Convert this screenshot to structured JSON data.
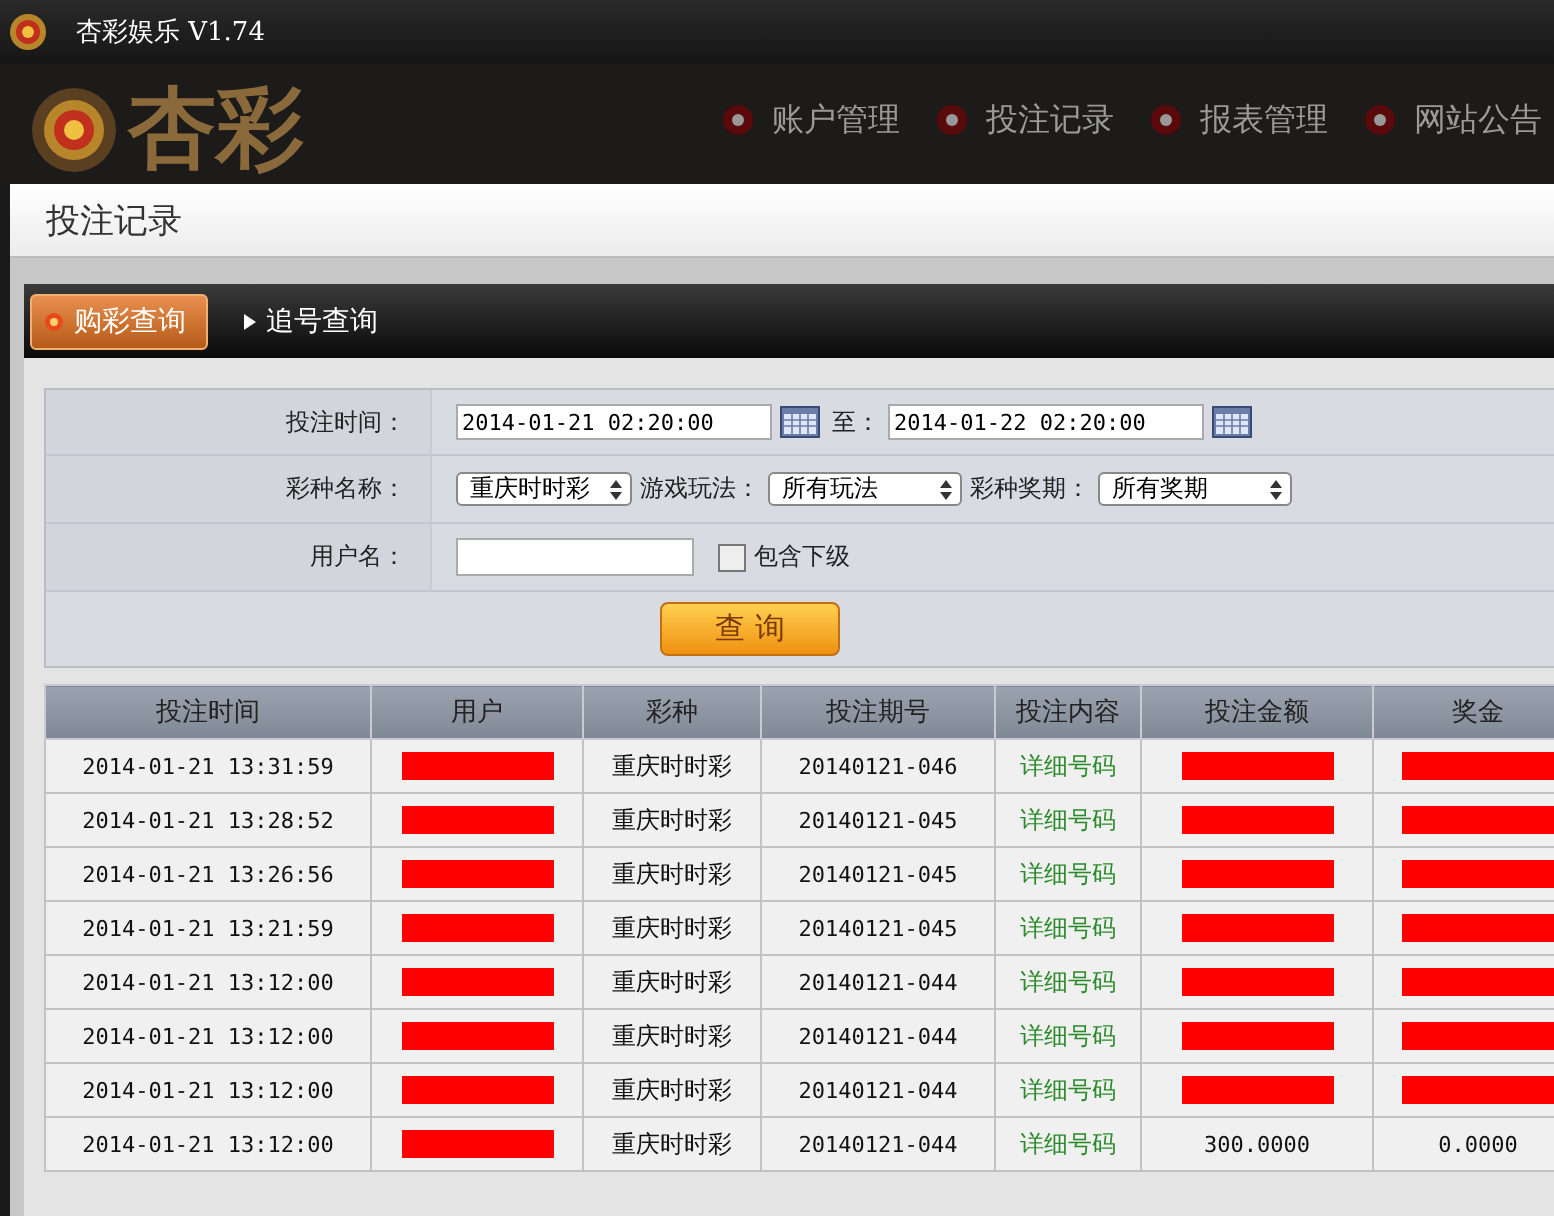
{
  "window": {
    "title": "杏彩娱乐 V1.74"
  },
  "header": {
    "logo_text": "杏彩",
    "nav": [
      {
        "label": "账户管理"
      },
      {
        "label": "投注记录"
      },
      {
        "label": "报表管理"
      },
      {
        "label": "网站公告"
      }
    ]
  },
  "page_title": "投注记录",
  "tabs": [
    {
      "label": "购彩查询",
      "selected": true
    },
    {
      "label": "追号查询",
      "selected": false
    }
  ],
  "form": {
    "time_label": "投注时间：",
    "start": "2014-01-21 02:20:00",
    "to_label": "至：",
    "end": "2014-01-22 02:20:00",
    "lottery_label": "彩种名称：",
    "lottery": "重庆时时彩",
    "play_label": "游戏玩法：",
    "play": "所有玩法",
    "issue_label": "彩种奖期：",
    "issue": "所有奖期",
    "user_label": "用户名：",
    "include_sub": {
      "label": "包含下级",
      "checked": false
    },
    "search_button": "查 询"
  },
  "table": {
    "columns": [
      "投注时间",
      "用户",
      "彩种",
      "投注期号",
      "投注内容",
      "投注金额",
      "奖金"
    ],
    "rows": [
      {
        "time": "2014-01-21 13:31:59",
        "user": {
          "redacted": true
        },
        "lottery": "重庆时时彩",
        "issue": "20140121-046",
        "content": "详细号码",
        "amount": {
          "redacted": true
        },
        "prize": {
          "redacted": true
        }
      },
      {
        "time": "2014-01-21 13:28:52",
        "user": {
          "redacted": true
        },
        "lottery": "重庆时时彩",
        "issue": "20140121-045",
        "content": "详细号码",
        "amount": {
          "redacted": true
        },
        "prize": {
          "redacted": true
        }
      },
      {
        "time": "2014-01-21 13:26:56",
        "user": {
          "redacted": true
        },
        "lottery": "重庆时时彩",
        "issue": "20140121-045",
        "content": "详细号码",
        "amount": {
          "redacted": true
        },
        "prize": {
          "redacted": true
        }
      },
      {
        "time": "2014-01-21 13:21:59",
        "user": {
          "redacted": true
        },
        "lottery": "重庆时时彩",
        "issue": "20140121-045",
        "content": "详细号码",
        "amount": {
          "redacted": true
        },
        "prize": {
          "redacted": true
        }
      },
      {
        "time": "2014-01-21 13:12:00",
        "user": {
          "redacted": true
        },
        "lottery": "重庆时时彩",
        "issue": "20140121-044",
        "content": "详细号码",
        "amount": {
          "redacted": true
        },
        "prize": {
          "redacted": true
        }
      },
      {
        "time": "2014-01-21 13:12:00",
        "user": {
          "redacted": true
        },
        "lottery": "重庆时时彩",
        "issue": "20140121-044",
        "content": "详细号码",
        "amount": {
          "redacted": true
        },
        "prize": {
          "redacted": true
        }
      },
      {
        "time": "2014-01-21 13:12:00",
        "user": {
          "redacted": true
        },
        "lottery": "重庆时时彩",
        "issue": "20140121-044",
        "content": "详细号码",
        "amount": {
          "redacted": true
        },
        "prize": {
          "redacted": true
        }
      },
      {
        "time": "2014-01-21 13:12:00",
        "user": {
          "redacted": true
        },
        "lottery": "重庆时时彩",
        "issue": "20140121-044",
        "content": "详细号码",
        "amount": {
          "redacted": false,
          "text": "300.0000"
        },
        "prize": {
          "redacted": false,
          "text": "0.0000"
        }
      }
    ]
  }
}
